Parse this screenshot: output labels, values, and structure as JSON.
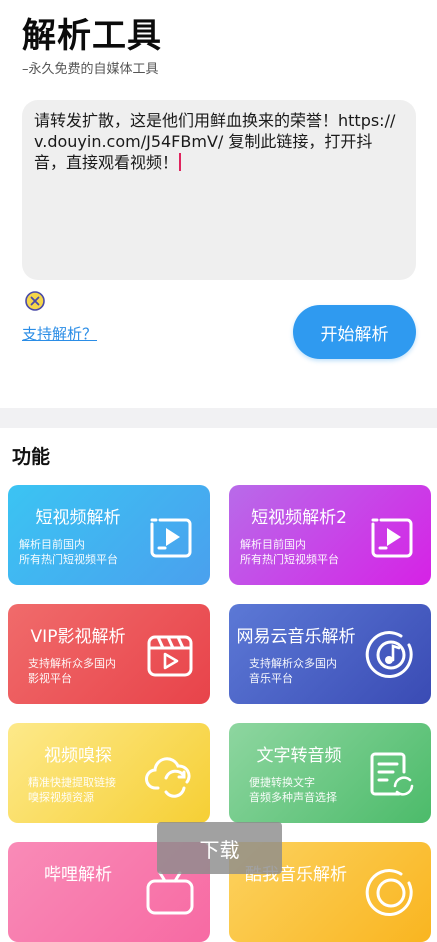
{
  "header": {
    "title": "解析工具",
    "subtitle": "–永久免费的自媒体工具"
  },
  "input": {
    "value": "请转发扩散，这是他们用鲜血换来的荣誉！https://v.douyin.com/J54FBmV/ 复制此链接，打开抖音，直接观看视频！"
  },
  "actions": {
    "help_link": "支持解析？",
    "start_label": "开始解析"
  },
  "features": {
    "section_title": "功能",
    "cards": [
      {
        "title": "短视频解析",
        "desc1": "解析目前国内",
        "desc2": "所有热门短视频平台",
        "icon": "video-play-icon",
        "colors": [
          "#3bc4f3",
          "#4aa0ee"
        ]
      },
      {
        "title": "短视频解析2",
        "desc1": "解析目前国内",
        "desc2": "所有热门短视频平台",
        "icon": "video-play-icon",
        "colors": [
          "#b86be9",
          "#d622e6"
        ]
      },
      {
        "title": "VIP影视解析",
        "desc1": "支持解析众多国内",
        "desc2": "影视平台",
        "icon": "clapperboard-icon",
        "colors": [
          "#f06b6b",
          "#e8434a"
        ]
      },
      {
        "title": "网易云音乐解析",
        "desc1": "支持解析众多国内",
        "desc2": "音乐平台",
        "icon": "music-disc-icon",
        "colors": [
          "#5c79d6",
          "#3a4bb4"
        ]
      },
      {
        "title": "视频嗅探",
        "desc1": "精准快捷提取链接",
        "desc2": "嗅探视频资源",
        "icon": "cloud-sync-icon",
        "colors": [
          "#fde98a",
          "#f6cf34"
        ]
      },
      {
        "title": "文字转音频",
        "desc1": "便捷转换文字",
        "desc2": "音频多种声音选择",
        "icon": "text-audio-icon",
        "colors": [
          "#8ed6a0",
          "#4cbb6a"
        ]
      },
      {
        "title": "哔哩解析",
        "colors": [
          "#f98bb7",
          "#f76aa3"
        ]
      },
      {
        "title": "酷我音乐解析",
        "colors": [
          "#fcd25f",
          "#f9b520"
        ]
      }
    ]
  },
  "overlay": {
    "download_label": "下载"
  }
}
